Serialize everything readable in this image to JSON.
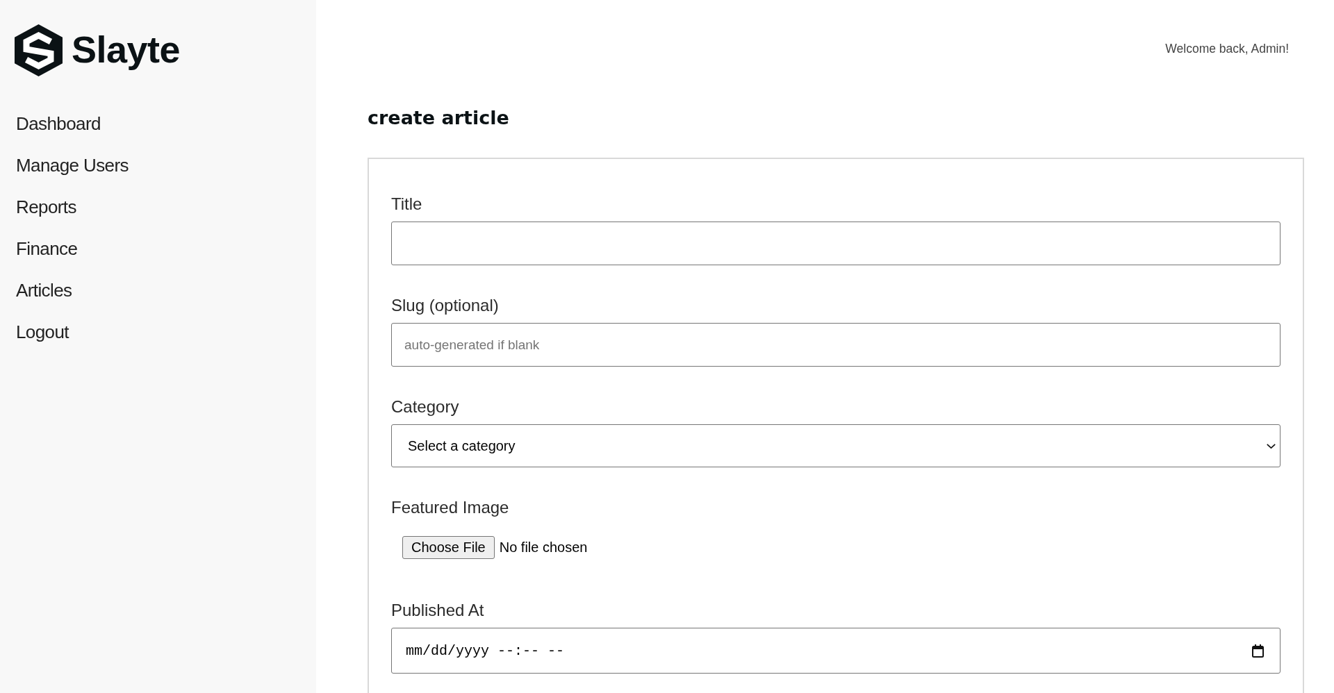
{
  "sidebar": {
    "logo": {
      "text": "Slayte"
    },
    "items": [
      {
        "label": "Dashboard"
      },
      {
        "label": "Manage Users"
      },
      {
        "label": "Reports"
      },
      {
        "label": "Finance"
      },
      {
        "label": "Articles"
      },
      {
        "label": "Logout"
      }
    ]
  },
  "header": {
    "greeting": "Welcome back, Admin!"
  },
  "page_title": "create article",
  "form": {
    "fields": [
      {
        "kind": "text",
        "label": "Title"
      },
      {
        "kind": "text",
        "label": "Slug (optional)",
        "placeholder": "auto-generated if blank"
      },
      {
        "kind": "select",
        "label": "Category",
        "value": "Select a category"
      },
      {
        "kind": "file",
        "label": "Featured Image",
        "button": "Choose File",
        "status": "No file chosen"
      },
      {
        "kind": "datetime",
        "label": "Published At",
        "placeholder": "mm/dd/yyyy --:-- --"
      }
    ]
  }
}
